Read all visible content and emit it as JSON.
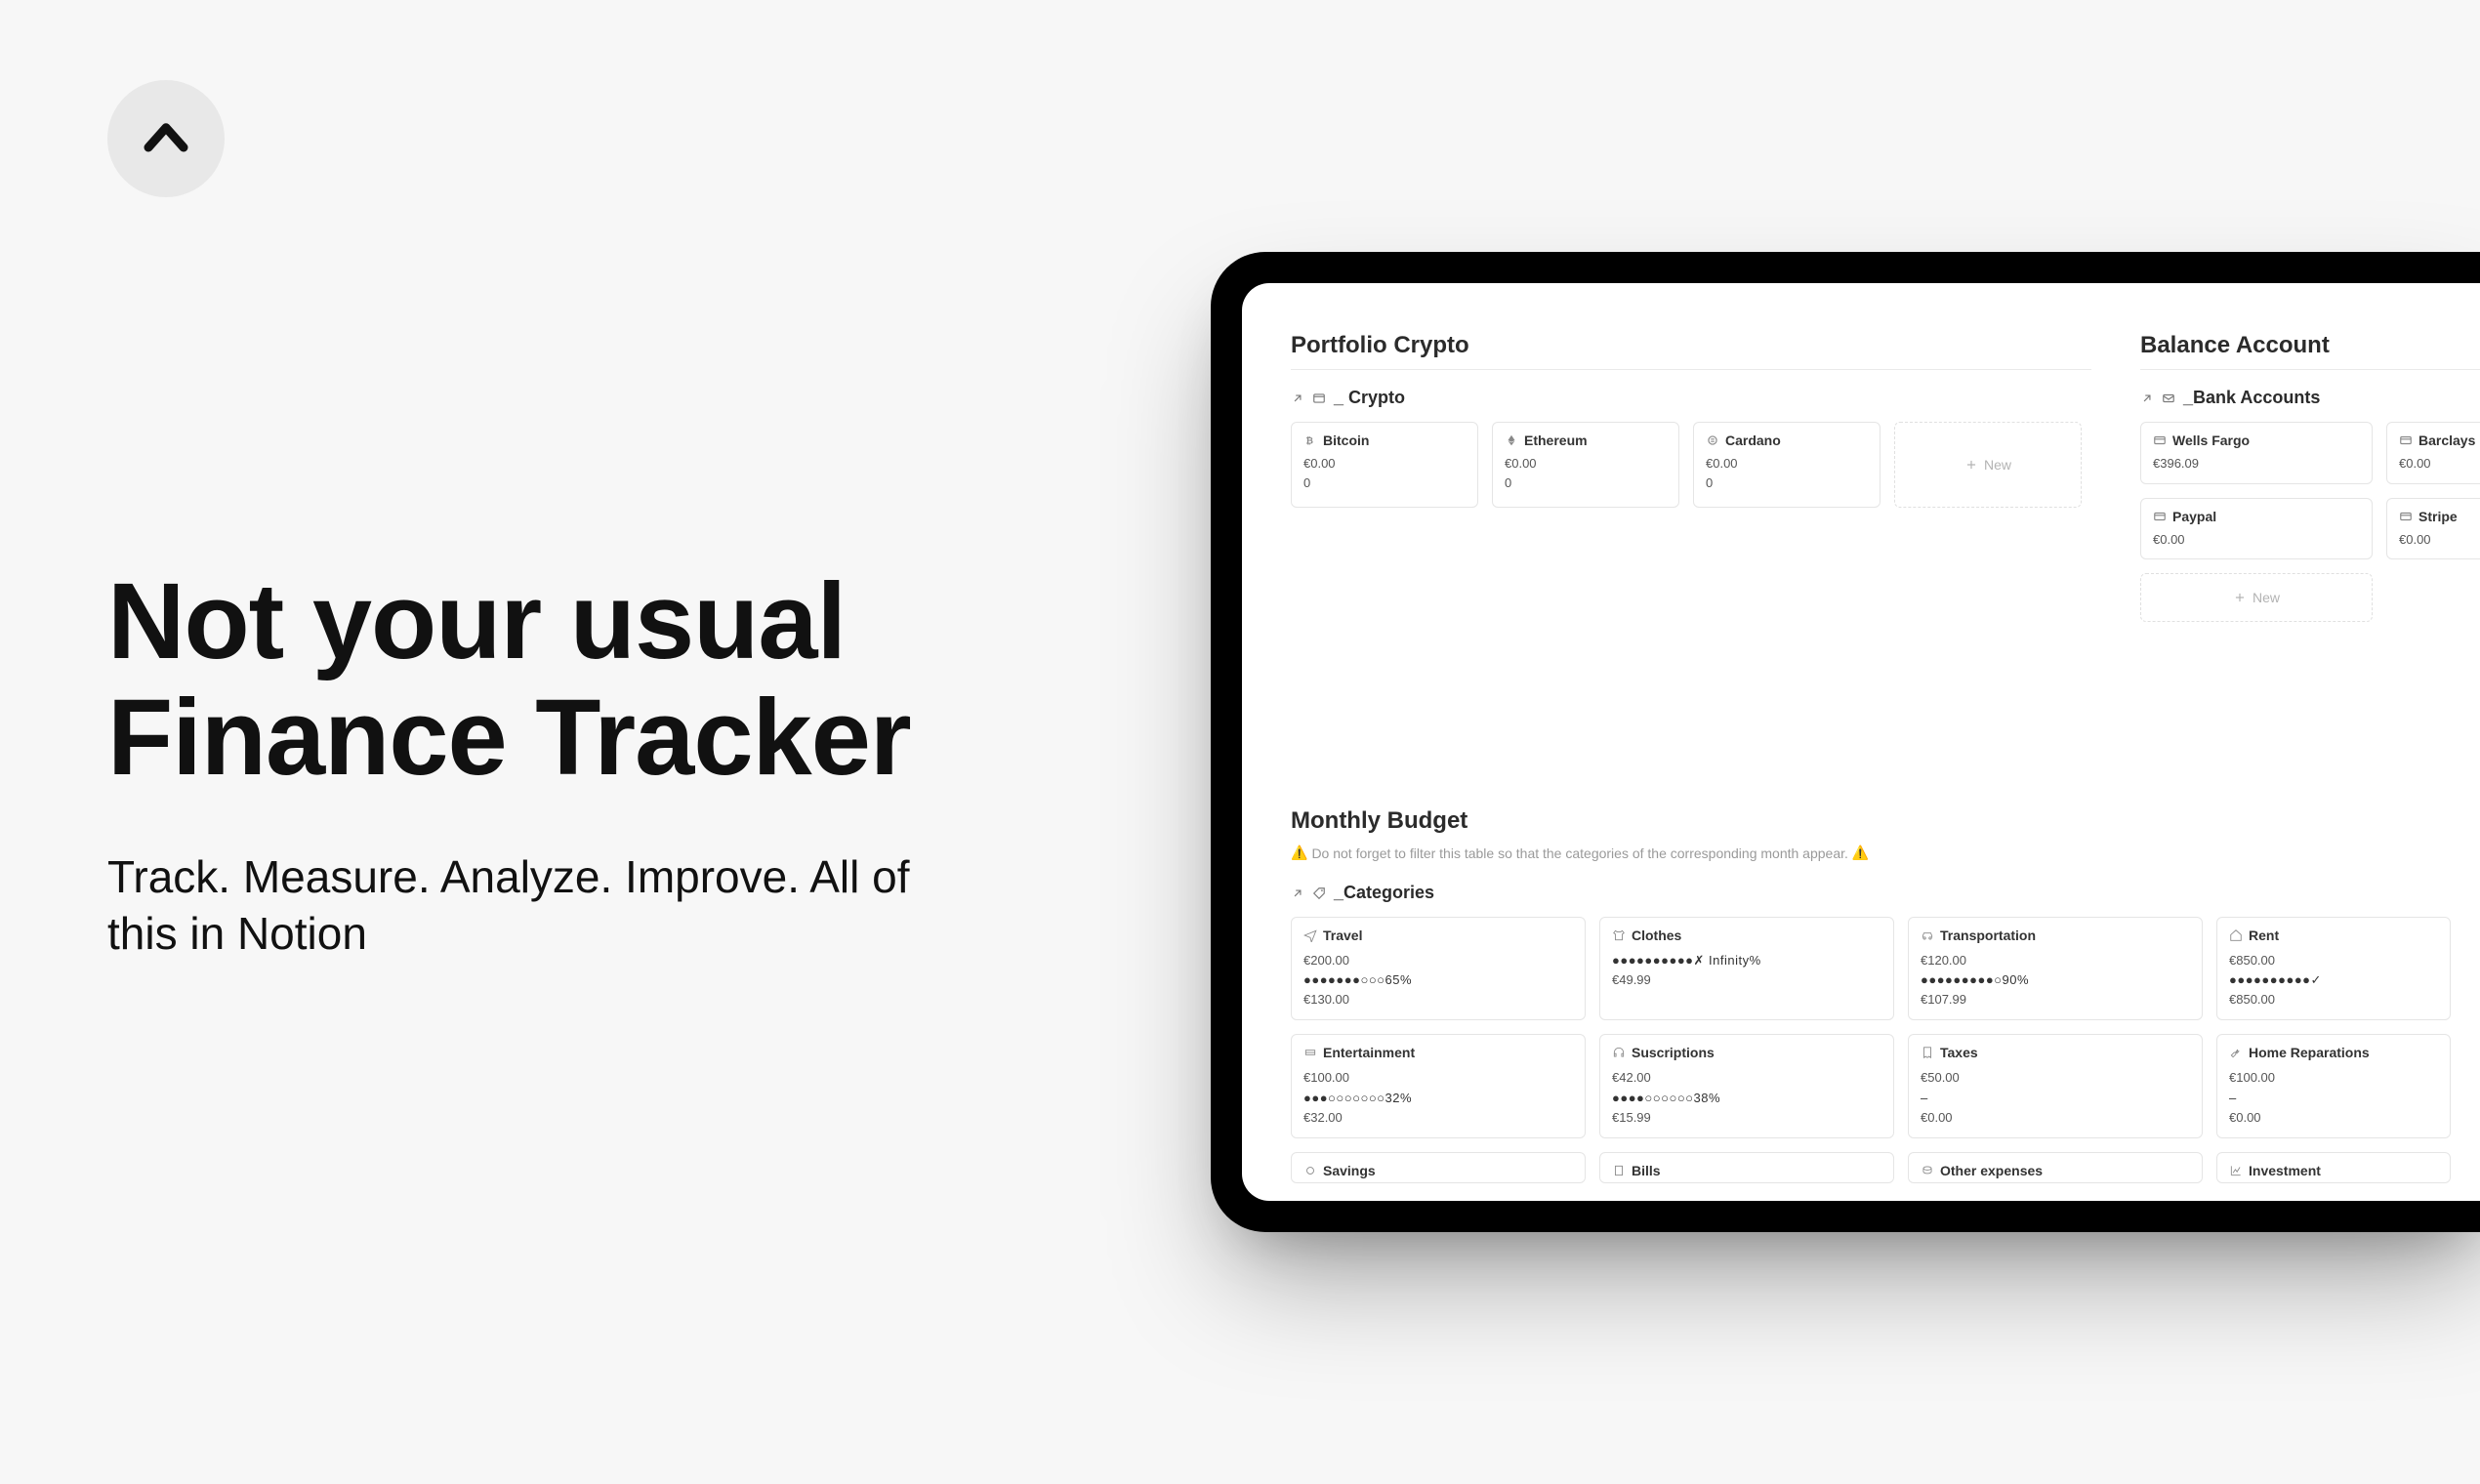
{
  "hero": {
    "title": "Not your usual Finance Tracker",
    "subtitle": "Track. Measure. Analyze. Improve. All of this in Notion"
  },
  "portfolio": {
    "title": "Portfolio Crypto",
    "view_label": "_ Crypto",
    "new_label": "New",
    "items": [
      {
        "name": "Bitcoin",
        "value": "€0.00",
        "qty": "0"
      },
      {
        "name": "Ethereum",
        "value": "€0.00",
        "qty": "0"
      },
      {
        "name": "Cardano",
        "value": "€0.00",
        "qty": "0"
      }
    ]
  },
  "balance": {
    "title": "Balance Account",
    "view_label": "_Bank Accounts",
    "new_label": "New",
    "accounts": [
      {
        "name": "Wells Fargo",
        "balance": "€396.09"
      },
      {
        "name": "Barclays",
        "balance": "€0.00"
      },
      {
        "name": "Paypal",
        "balance": "€0.00"
      },
      {
        "name": "Stripe",
        "balance": "€0.00"
      }
    ]
  },
  "budget": {
    "title": "Monthly Budget",
    "warning_icon": "⚠️",
    "warning_text": "Do not forget to filter this table so that the categories of the corresponding month appear.",
    "view_label": "_Categories",
    "categories": [
      {
        "name": "Travel",
        "amount": "€200.00",
        "progress": "●●●●●●●○○○65%",
        "spent": "€130.00"
      },
      {
        "name": "Clothes",
        "amount": "",
        "progress": "●●●●●●●●●●✗ Infinity%",
        "spent": "€49.99"
      },
      {
        "name": "Transportation",
        "amount": "€120.00",
        "progress": "●●●●●●●●●○90%",
        "spent": "€107.99"
      },
      {
        "name": "Rent",
        "amount": "€850.00",
        "progress": "●●●●●●●●●●✓",
        "spent": "€850.00"
      },
      {
        "name": "Entertainment",
        "amount": "€100.00",
        "progress": "●●●○○○○○○○32%",
        "spent": "€32.00"
      },
      {
        "name": "Suscriptions",
        "amount": "€42.00",
        "progress": "●●●●○○○○○○38%",
        "spent": "€15.99"
      },
      {
        "name": "Taxes",
        "amount": "€50.00",
        "progress": "–",
        "spent": "€0.00"
      },
      {
        "name": "Home Reparations",
        "amount": "€100.00",
        "progress": "–",
        "spent": "€0.00"
      }
    ],
    "peek": [
      {
        "name": "Savings"
      },
      {
        "name": "Bills"
      },
      {
        "name": "Other expenses"
      },
      {
        "name": "Investment"
      }
    ]
  }
}
